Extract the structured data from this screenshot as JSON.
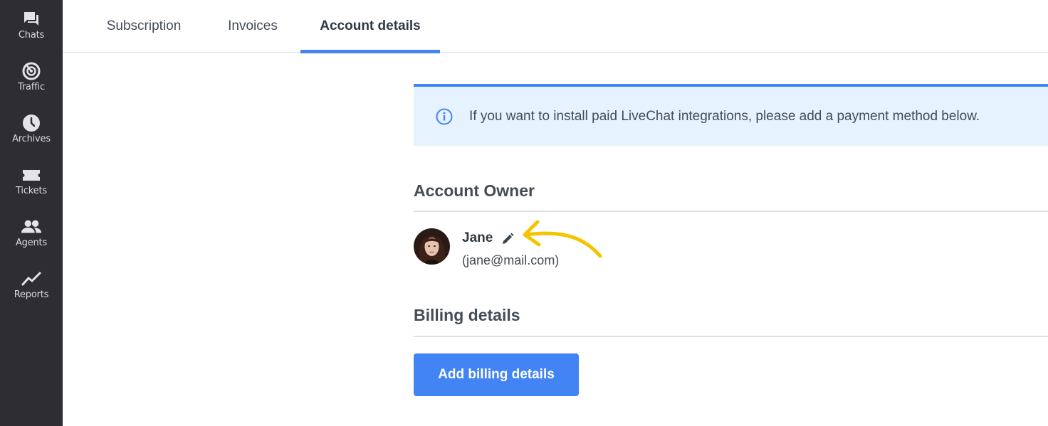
{
  "sidebar": {
    "items": [
      {
        "label": "Chats",
        "icon": "chats-icon"
      },
      {
        "label": "Traffic",
        "icon": "traffic-icon"
      },
      {
        "label": "Archives",
        "icon": "archives-icon"
      },
      {
        "label": "Tickets",
        "icon": "tickets-icon"
      },
      {
        "label": "Agents",
        "icon": "agents-icon"
      },
      {
        "label": "Reports",
        "icon": "reports-icon"
      }
    ]
  },
  "tabs": [
    {
      "label": "Subscription",
      "active": false
    },
    {
      "label": "Invoices",
      "active": false
    },
    {
      "label": "Account details",
      "active": true
    }
  ],
  "info": {
    "text": "If you want to install paid LiveChat integrations, please add a payment method below."
  },
  "account_owner": {
    "title": "Account Owner",
    "name": "Jane",
    "email": "(jane@mail.com)"
  },
  "billing": {
    "title": "Billing details",
    "button_label": "Add billing details"
  },
  "colors": {
    "sidebar_bg": "#2d2d33",
    "accent": "#4384f5",
    "info_bg": "#e6f2fe",
    "annotation_arrow": "#f5c400"
  }
}
